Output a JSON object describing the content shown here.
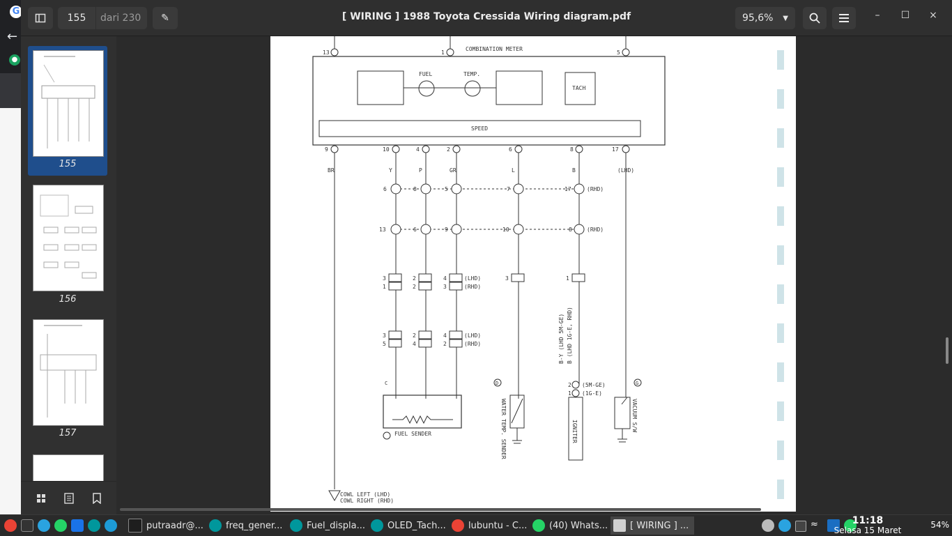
{
  "window": {
    "title": "[ WIRING ] 1988 Toyota Cressida Wiring diagram.pdf"
  },
  "pager": {
    "current": "155",
    "of_label": "dari 230"
  },
  "zoom": {
    "level": "95,6%"
  },
  "sidebar": {
    "thumbnails": [
      {
        "page": "155",
        "selected": true
      },
      {
        "page": "156",
        "selected": false
      },
      {
        "page": "157",
        "selected": false
      }
    ]
  },
  "diagram": {
    "title": "COMBINATION METER",
    "top_pins": [
      "13",
      "1",
      "5"
    ],
    "gauges": [
      "FUEL",
      "TEMP."
    ],
    "tach": "TACH",
    "speed": "SPEED",
    "bottom_pins": [
      "9",
      "10",
      "4",
      "2",
      "6",
      "8",
      "17"
    ],
    "wire_colors": [
      "BR",
      "Y",
      "P",
      "GR",
      "L",
      "B",
      "(LHD)"
    ],
    "connector_sh": [
      "6",
      "8",
      "5",
      "7",
      "17",
      "(RHD)"
    ],
    "connector_sf": [
      "13",
      "6",
      "9",
      "10",
      "8",
      "(RHD)"
    ],
    "connector_h1": [
      "3",
      "2",
      "4",
      "(LHD)",
      "1",
      "2",
      "3",
      "(RHD)",
      "3",
      "1"
    ],
    "connector_d2": [
      "3",
      "2",
      "4",
      "(LHD)",
      "5",
      "4",
      "2",
      "(RHD)"
    ],
    "fuel_sender": "FUEL SENDER",
    "water_temp": "WATER TEMP. SENDER",
    "igniter": "IGNITER",
    "igniter_labels": [
      "2",
      "(5M-GE)",
      "1",
      "(1G-E)"
    ],
    "igniter_wire": "B-Y (LHD 5M-GE)",
    "igniter_wire2": "B (LHD 1G-E, RHD)",
    "vacuum": "VACUUM S/W",
    "marks": [
      "C",
      "D",
      "G"
    ],
    "cowl": [
      "COWL LEFT (LHD)",
      "COWL RIGHT (RHD)"
    ]
  },
  "taskbar": {
    "tasks": [
      {
        "label": "putraadr@...",
        "color": "#1e1e1e"
      },
      {
        "label": "freq_gener...",
        "color": "#00979c"
      },
      {
        "label": "Fuel_displa...",
        "color": "#00979c"
      },
      {
        "label": "OLED_Tach...",
        "color": "#00979c"
      },
      {
        "label": "lubuntu - C...",
        "color": "#ea4335"
      },
      {
        "label": "(40) Whats...",
        "color": "#25d366"
      },
      {
        "label": "[ WIRING ] ...",
        "color": "#d0d0d0"
      }
    ],
    "time": "11:18",
    "date": "Selasa 15 Maret",
    "battery": "54%"
  }
}
